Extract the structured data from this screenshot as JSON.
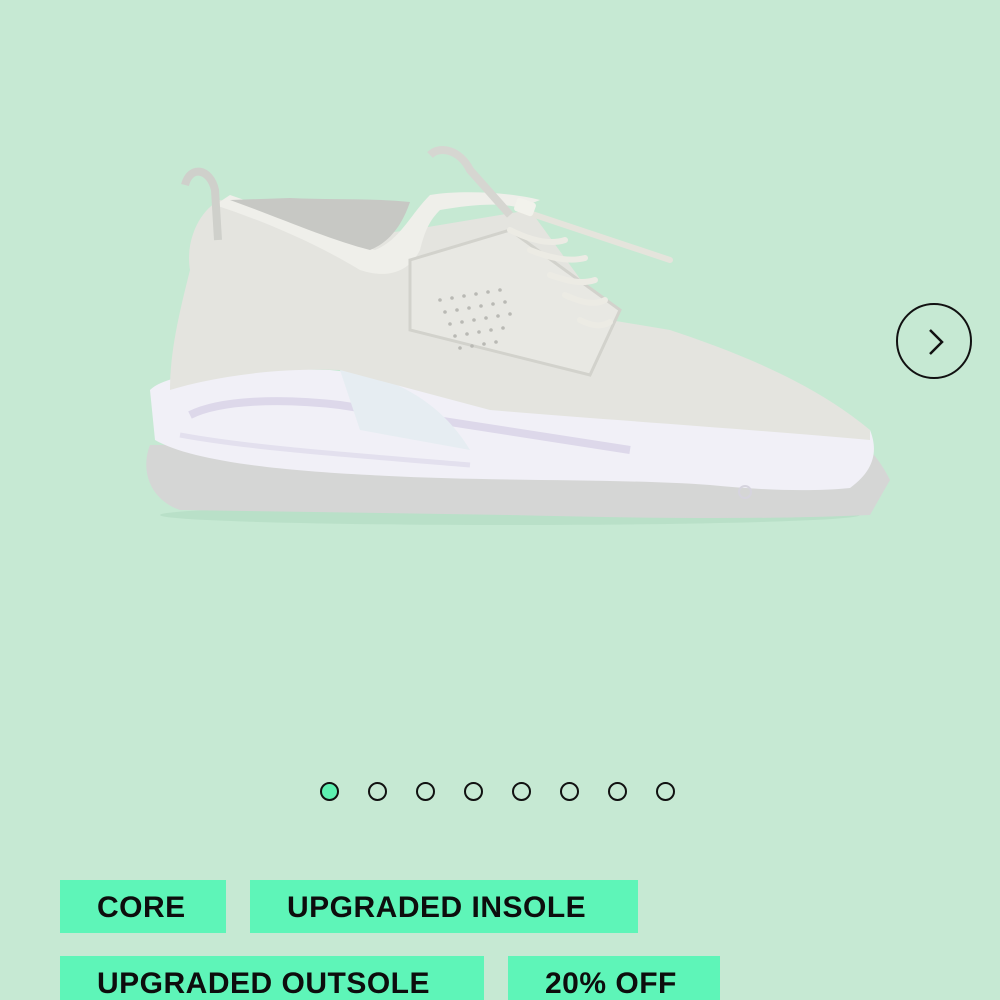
{
  "product": {
    "image_alt": "Product image"
  },
  "carousel": {
    "slide_count": 8,
    "active_index": 0,
    "next_icon": "chevron-right-icon"
  },
  "badges": {
    "core": "CORE",
    "insole": "UPGRADED INSOLE",
    "outsole": "UPGRADED OUTSOLE",
    "discount": "20% OFF"
  },
  "colors": {
    "background": "#c6e9d3",
    "badge": "#5ef5b8",
    "active_dot": "#5ef0b0"
  }
}
